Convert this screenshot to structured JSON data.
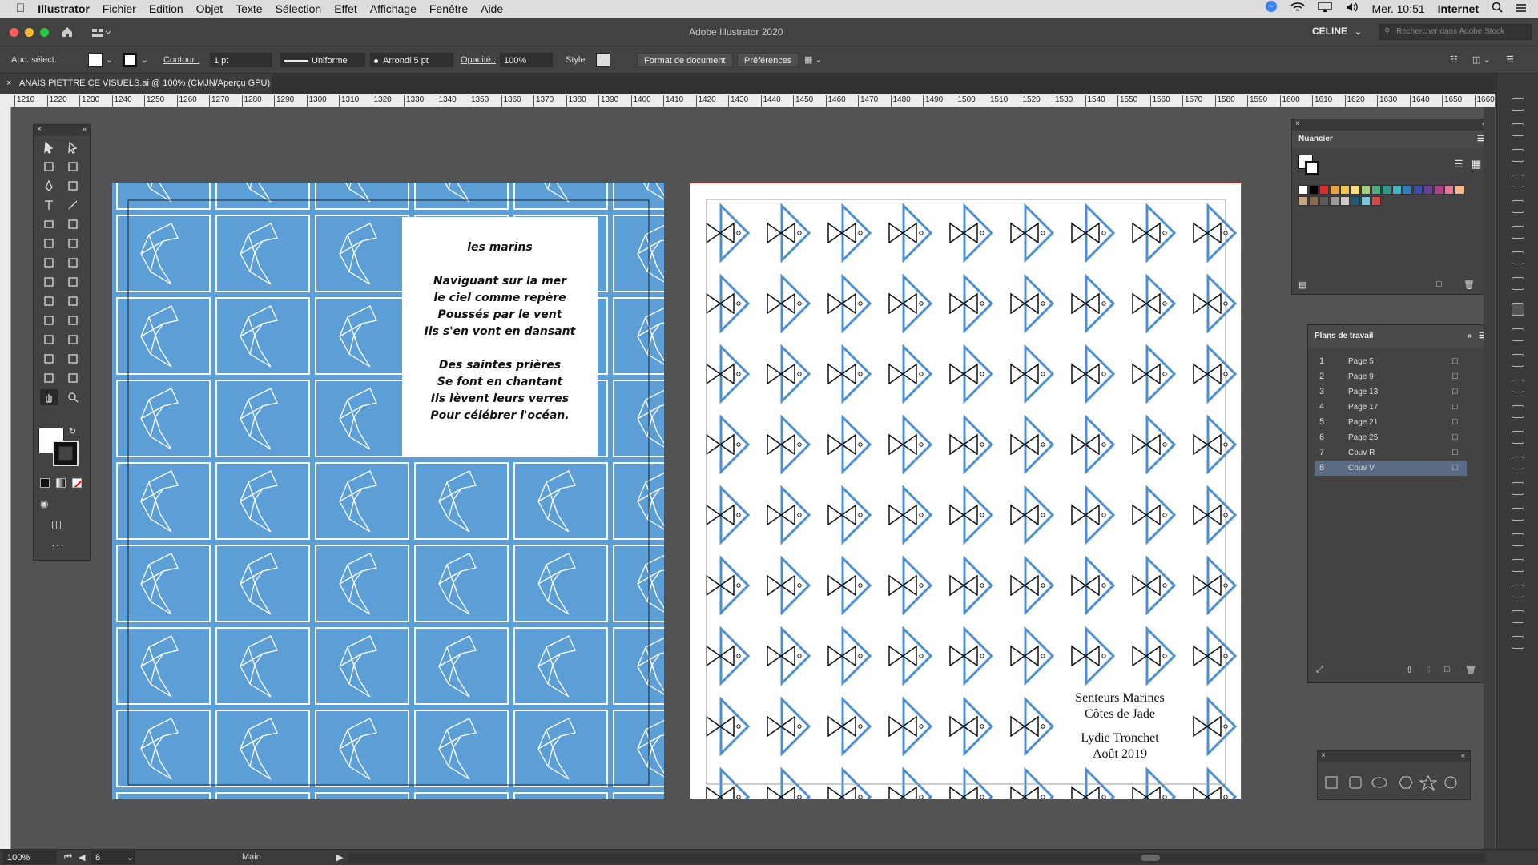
{
  "menubar": {
    "apple": "",
    "app_name": "Illustrator",
    "items": [
      "Fichier",
      "Edition",
      "Objet",
      "Texte",
      "Sélection",
      "Effet",
      "Affichage",
      "Fenêtre",
      "Aide"
    ],
    "clock": "Mer. 10:51",
    "network": "Internet"
  },
  "titlebar": {
    "title": "Adobe Illustrator 2020",
    "workspace": "CELINE",
    "search_placeholder": "Rechercher dans Adobe Stock"
  },
  "control_bar": {
    "selection": "Auc. sélect.",
    "stroke_label": "Contour :",
    "stroke_value": "1 pt",
    "profile": "Uniforme",
    "brush": "Arrondi 5 pt",
    "opacity_label": "Opacité :",
    "opacity_value": "100%",
    "style_label": "Style :",
    "doc_setup": "Format de document",
    "preferences": "Préférences"
  },
  "document": {
    "tab_title": "ANAIS PIETTRE CE VISUELS.ai @ 100% (CMJN/Aperçu GPU)"
  },
  "ruler": {
    "ticks": [
      "1210",
      "1220",
      "1230",
      "1240",
      "1250",
      "1260",
      "1270",
      "1280",
      "1290",
      "1300",
      "1310",
      "1320",
      "1330",
      "1340",
      "1350",
      "1360",
      "1370",
      "1380",
      "1390",
      "1400",
      "1410",
      "1420",
      "1430",
      "1440",
      "1450",
      "1460",
      "1470",
      "1480",
      "1490",
      "1500",
      "1510",
      "1520",
      "1530",
      "1540",
      "1550",
      "1560",
      "1570",
      "1580",
      "1590",
      "1600",
      "1610",
      "1620",
      "1630",
      "1640",
      "1650",
      "1660"
    ]
  },
  "poem": {
    "title": "les marins",
    "stanza1": [
      "Naviguant sur la mer",
      "le ciel comme repère",
      "Poussés par le vent",
      "Ils s'en vont en dansant"
    ],
    "stanza2": [
      "Des saintes prières",
      "Se font en chantant",
      "Ils lèvent leurs verres",
      "Pour célébrer l'océan."
    ]
  },
  "cover": {
    "line1": "Senteurs Marines",
    "line2": "Côtes de Jade",
    "line3": "Lydie Tronchet",
    "line4": "Août 2019"
  },
  "swatches_panel": {
    "title": "Nuancier",
    "colors": [
      "#ffffff",
      "#000000",
      "#e02a2a",
      "#e8a23a",
      "#f2c84b",
      "#f7e07a",
      "#9fd27b",
      "#4caf7d",
      "#2e9a8a",
      "#3fb3c8",
      "#2e7dc2",
      "#3b4fa8",
      "#6a3f9a",
      "#b43d8c",
      "#e8789a",
      "#f3b98a",
      "#c8a67a",
      "#8a6a4a",
      "#5a5a5a",
      "#9a9a9a",
      "#cccccc",
      "#1e5a7a",
      "#7ac8d8",
      "#d84a4a"
    ]
  },
  "artboards_panel": {
    "title": "Plans de travail",
    "items": [
      {
        "num": "1",
        "name": "Page 5"
      },
      {
        "num": "2",
        "name": "Page 9"
      },
      {
        "num": "3",
        "name": "Page 13"
      },
      {
        "num": "4",
        "name": "Page 17"
      },
      {
        "num": "5",
        "name": "Page 21"
      },
      {
        "num": "6",
        "name": "Page 25"
      },
      {
        "num": "7",
        "name": "Couv R"
      },
      {
        "num": "8",
        "name": "Couv V"
      }
    ],
    "selected": "8"
  },
  "statusbar": {
    "zoom": "100%",
    "artboard": "8",
    "tool": "Main"
  },
  "colors": {
    "pattern_blue": "#5b9fd6",
    "fish_blue": "#4a90d0",
    "ui_dark": "#424242"
  }
}
